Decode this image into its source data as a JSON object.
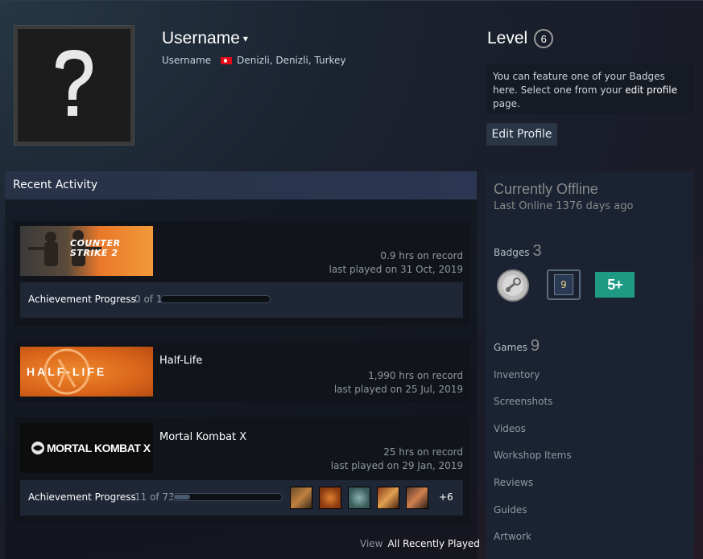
{
  "profile": {
    "username": "Username",
    "caret": "▾",
    "real_name": "Username",
    "location": "Denizli, Denizli, Turkey"
  },
  "level": {
    "label": "Level",
    "value": "6"
  },
  "badge_feature": {
    "text_pre": "You can feature one of your Badges here. Select one from your ",
    "link": "edit profile",
    "text_post": " page."
  },
  "edit_profile_label": "Edit Profile",
  "recent_activity": {
    "title": "Recent Activity",
    "games": [
      {
        "name": "",
        "capsule_text": "COUNTER STRIKE 2",
        "hours": "0.9 hrs on record",
        "last_played": "last played on 31 Oct, 2019",
        "achievement_label": "Achievement Progress",
        "achievement_count": "0 of 1",
        "achievement_progress": 0
      },
      {
        "name": "Half-Life",
        "capsule_text": "HALF-LIFE",
        "hours": "1,990 hrs on record",
        "last_played": "last played on 25 Jul, 2019"
      },
      {
        "name": "Mortal Kombat X",
        "capsule_text": "MORTAL KOMBAT X",
        "hours": "25 hrs on record",
        "last_played": "last played on 29 Jan, 2019",
        "achievement_label": "Achievement Progress",
        "achievement_count": "11 of 73",
        "achievement_progress": 0.15,
        "more": "+6"
      }
    ],
    "view_label": "View",
    "view_all_label": "All Recently Played"
  },
  "status": {
    "title": "Currently Offline",
    "last_online": "Last Online 1376 days ago"
  },
  "sidebar": {
    "badges_label": "Badges",
    "badges_count": "3",
    "badge_level_num": "9",
    "badge_years": "5+",
    "games_label": "Games",
    "games_count": "9",
    "links": [
      "Inventory",
      "Screenshots",
      "Videos",
      "Workshop Items",
      "Reviews",
      "Guides",
      "Artwork"
    ]
  },
  "colors": {
    "background": "#1b2230",
    "panel": "#1b2231",
    "header_blue": "#2b3652",
    "cs2_orange": "#e9782a",
    "halflife_orange": "#e2741f"
  }
}
